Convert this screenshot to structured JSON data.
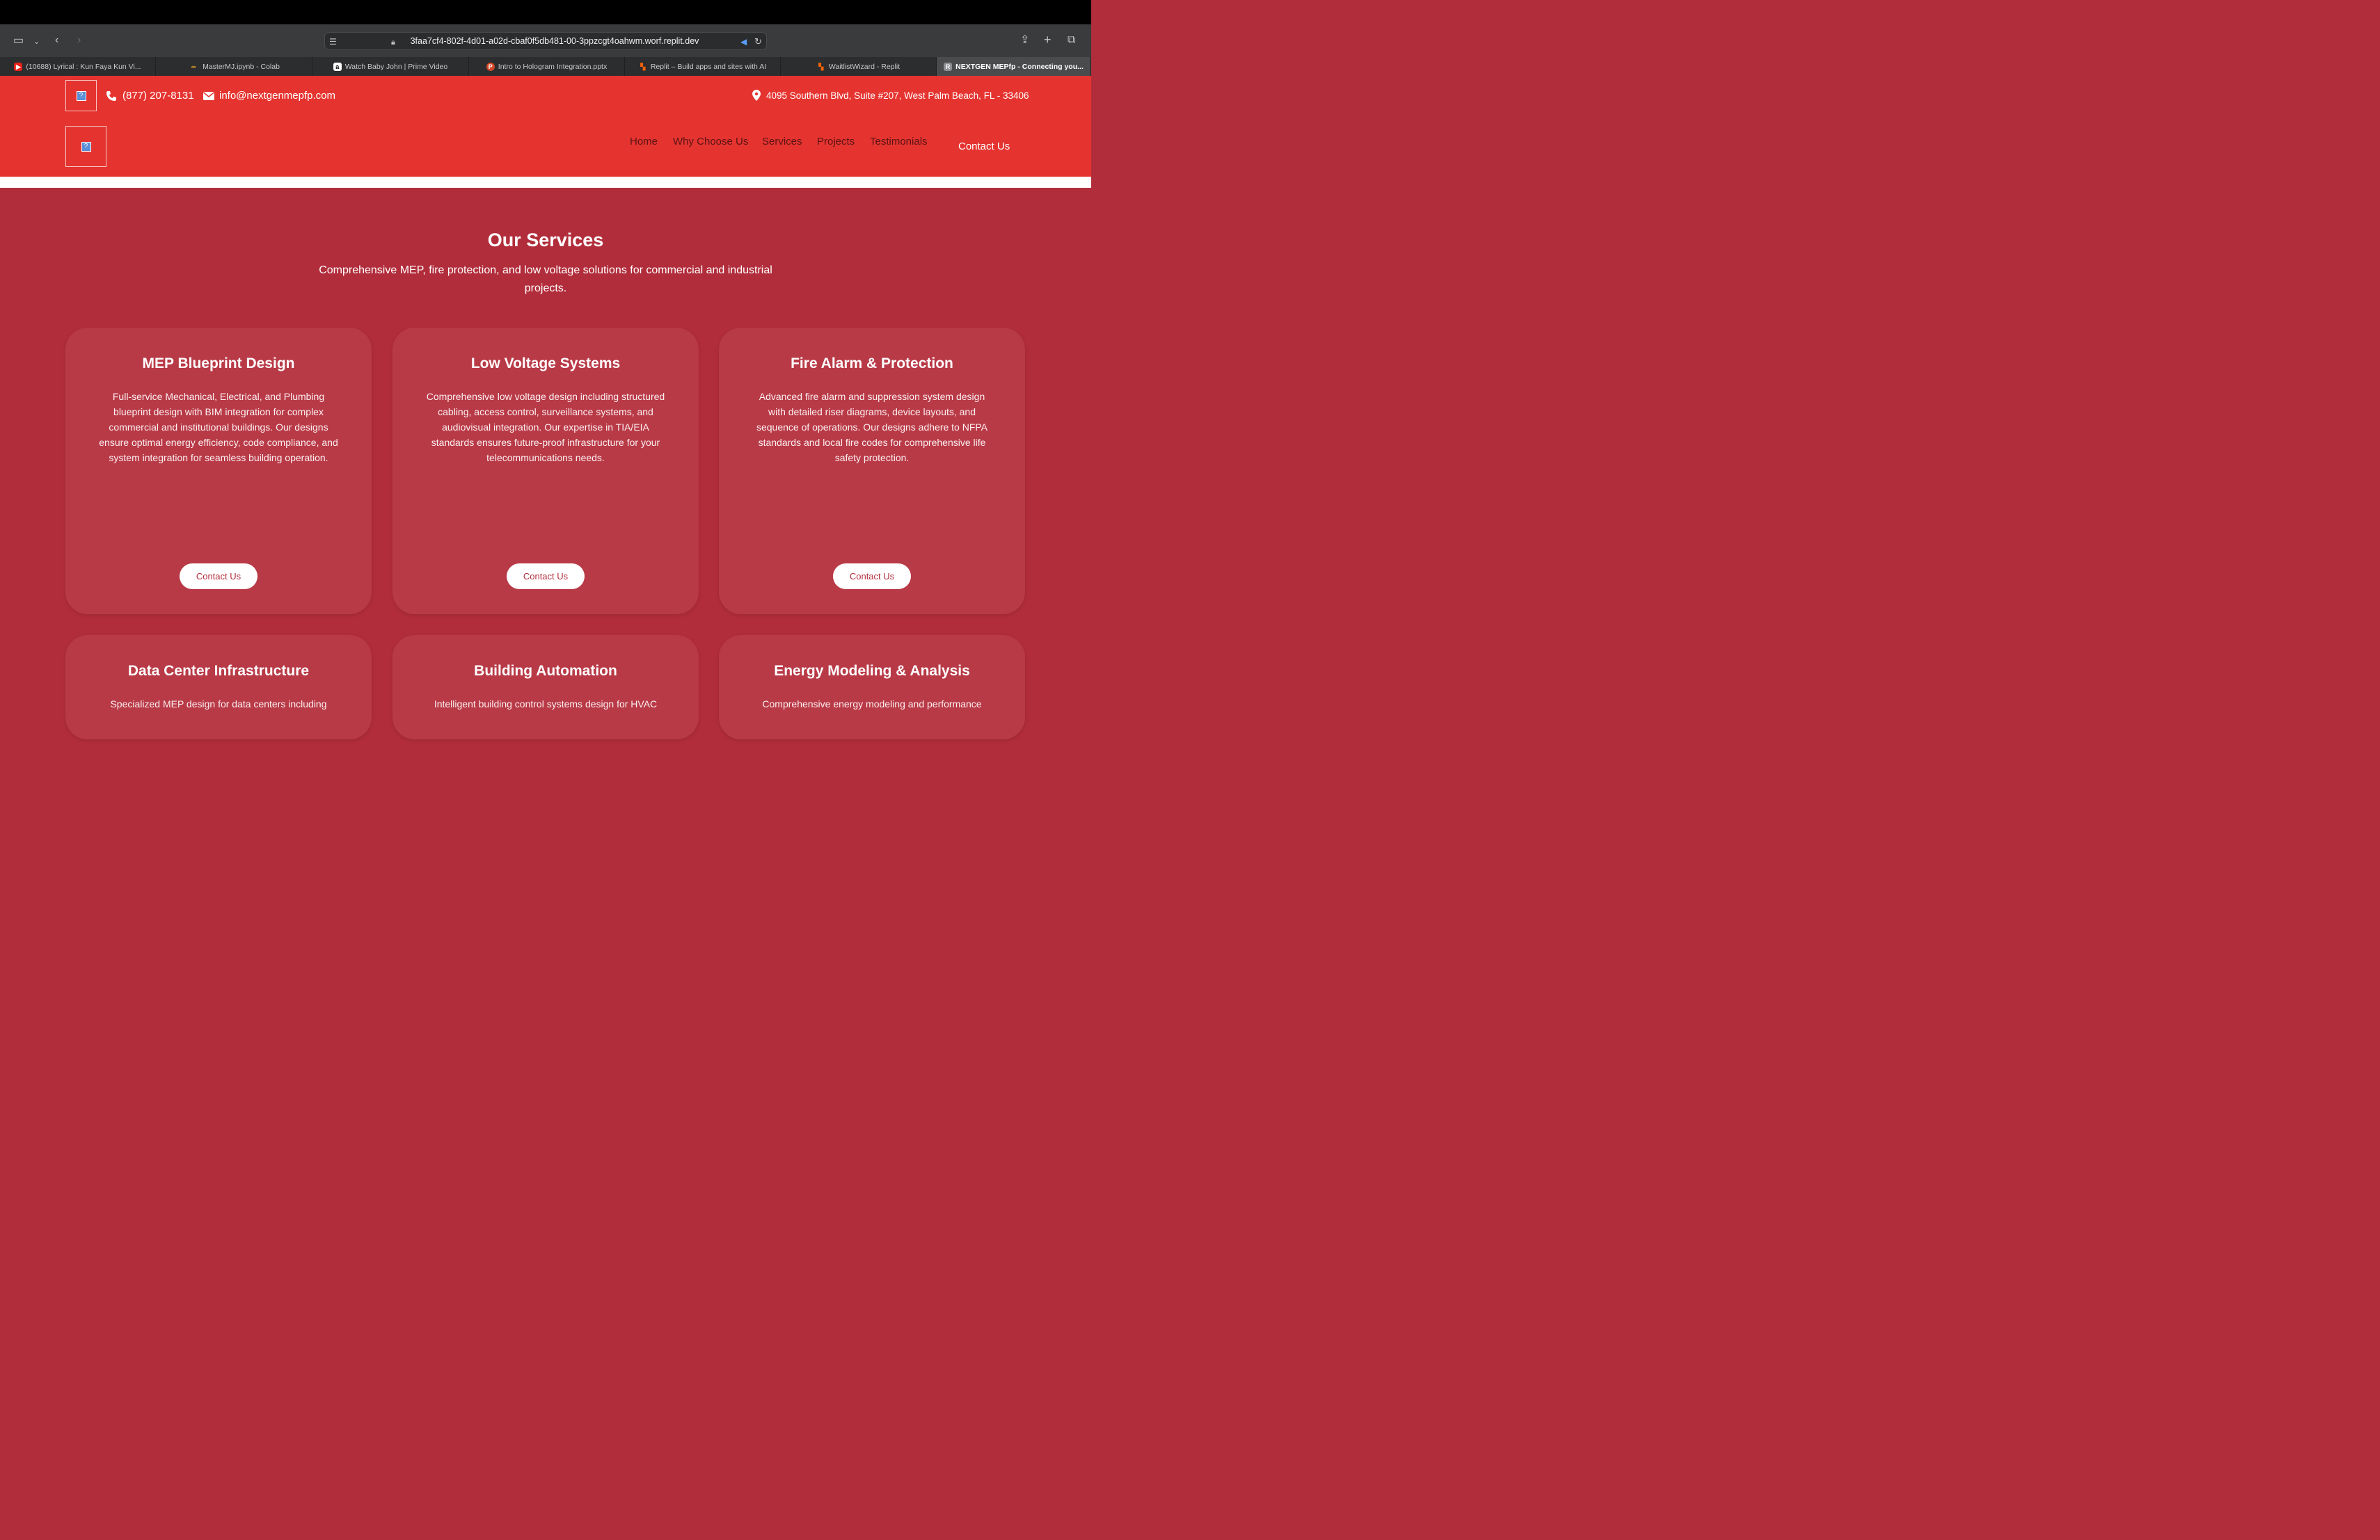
{
  "browser": {
    "url": "3faa7cf4-802f-4d01-a02d-cbaf0f5db481-00-3ppzcgt4oahwm.worf.replit.dev",
    "tabs": [
      {
        "label": "(10688) Lyrical : Kun Faya Kun Vi...",
        "icon": "youtube-icon",
        "active": false
      },
      {
        "label": "MasterMJ.ipynb - Colab",
        "icon": "colab-icon",
        "active": false
      },
      {
        "label": "Watch Baby John | Prime Video",
        "icon": "amazon-icon",
        "active": false
      },
      {
        "label": "Intro to Hologram Integration.pptx",
        "icon": "powerpoint-icon",
        "active": false
      },
      {
        "label": "Replit – Build apps and sites with AI",
        "icon": "replit-icon",
        "active": false
      },
      {
        "label": "WaitlistWizard - Replit",
        "icon": "replit-icon",
        "active": false
      },
      {
        "label": "NEXTGEN MEPfp - Connecting you...",
        "icon": "r-icon",
        "active": true
      }
    ]
  },
  "header": {
    "phone": "(877) 207-8131",
    "email": "info@nextgenmepfp.com",
    "address": "4095 Southern Blvd, Suite #207, West Palm Beach, FL - 33406",
    "nav": [
      "Home",
      "Why Choose Us",
      "Services",
      "Projects",
      "Testimonials"
    ],
    "cta": "Contact Us"
  },
  "services": {
    "title": "Our Services",
    "subtitle": "Comprehensive MEP, fire protection, and low voltage solutions for commercial and industrial projects.",
    "cards": [
      {
        "title": "MEP Blueprint Design",
        "description": "Full-service Mechanical, Electrical, and Plumbing blueprint design with BIM integration for complex commercial and institutional buildings. Our designs ensure optimal energy efficiency, code compliance, and system integration for seamless building operation.",
        "button": "Contact Us"
      },
      {
        "title": "Low Voltage Systems",
        "description": "Comprehensive low voltage design including structured cabling, access control, surveillance systems, and audiovisual integration. Our expertise in TIA/EIA standards ensures future-proof infrastructure for your telecommunications needs.",
        "button": "Contact Us"
      },
      {
        "title": "Fire Alarm & Protection",
        "description": "Advanced fire alarm and suppression system design with detailed riser diagrams, device layouts, and sequence of operations. Our designs adhere to NFPA standards and local fire codes for comprehensive life safety protection.",
        "button": "Contact Us"
      },
      {
        "title": "Data Center Infrastructure",
        "description": "Specialized MEP design for data centers including"
      },
      {
        "title": "Building Automation",
        "description": "Intelligent building control systems design for HVAC"
      },
      {
        "title": "Energy Modeling & Analysis",
        "description": "Comprehensive energy modeling and performance"
      }
    ]
  },
  "colors": {
    "header": "#e53430",
    "section": "#b22d3b",
    "card": "#b93a47"
  }
}
